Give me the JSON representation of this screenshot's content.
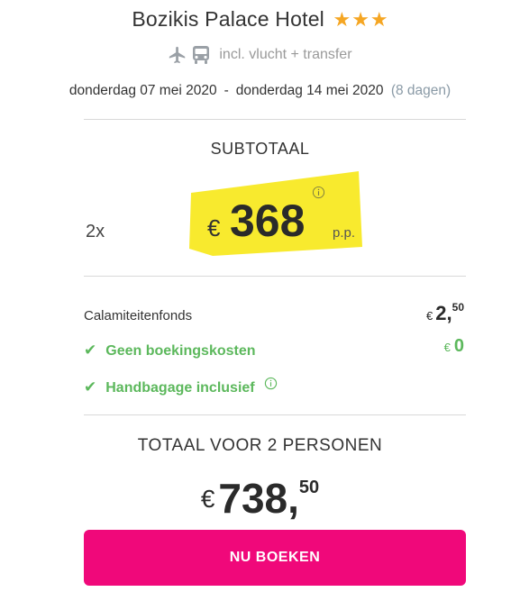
{
  "header": {
    "hotel_name": "Bozikis Palace Hotel",
    "star_count": 3,
    "star_color": "#f5a623",
    "star_glyph": "★",
    "icons": [
      "plane-icon",
      "bus-icon"
    ],
    "incl_text": "incl. vlucht + transfer"
  },
  "dates": {
    "start": "donderdag 07 mei 2020",
    "separator": "-",
    "end": "donderdag 14 mei 2020",
    "days": "(8 dagen)"
  },
  "subtotal": {
    "label": "SUBTOTAAL",
    "quantity": "2x",
    "currency": "€",
    "price": "368",
    "per_person": "p.p.",
    "info_icon": "info-icon",
    "highlight_color": "#f7e81c"
  },
  "costs": {
    "calamity_label": "Calamiteitenfonds",
    "calamity_currency": "€",
    "calamity_int": "2,",
    "calamity_dec": "50",
    "features": [
      {
        "label": "Geen boekingskosten",
        "icon": "check-icon"
      },
      {
        "label": "Handbagage inclusief",
        "icon": "check-icon"
      }
    ],
    "booking_fee_currency": "€",
    "booking_fee_value": "0",
    "accent_green": "#5cb85c"
  },
  "total": {
    "label": "TOTAAL VOOR 2 PERSONEN",
    "currency": "€",
    "int": "738,",
    "dec": "50"
  },
  "cta": {
    "label": "NU BOEKEN",
    "color": "#f0087a"
  }
}
